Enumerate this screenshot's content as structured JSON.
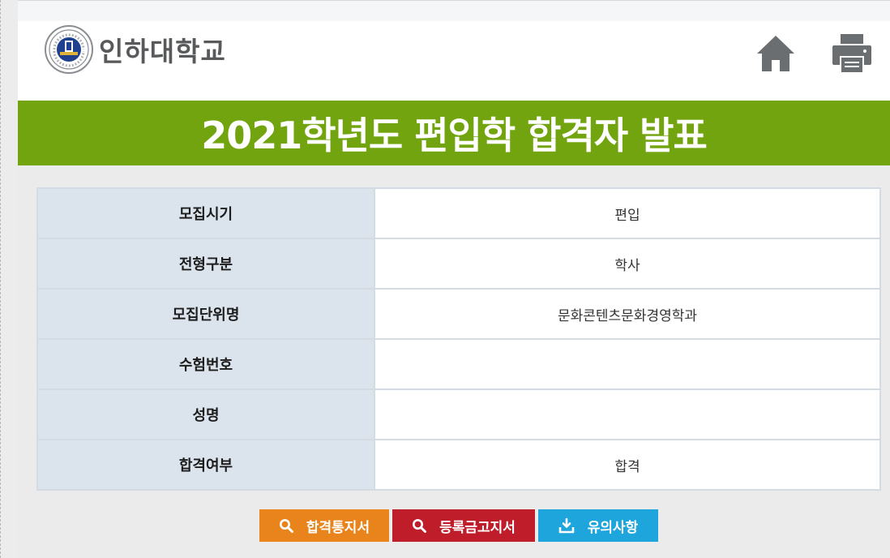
{
  "header": {
    "logo_text": "인하대학교",
    "seal_text": "INHA"
  },
  "banner": {
    "title": "2021학년도 편입학 합격자 발표"
  },
  "table": {
    "rows": [
      {
        "label": "모집시기",
        "value": "편입"
      },
      {
        "label": "전형구분",
        "value": "학사"
      },
      {
        "label": "모집단위명",
        "value": "문화콘텐츠문화경영학과"
      },
      {
        "label": "수험번호",
        "value": ""
      },
      {
        "label": "성명",
        "value": ""
      },
      {
        "label": "합격여부",
        "value": "합격"
      }
    ]
  },
  "buttons": {
    "acceptance_letter": "합격통지서",
    "tuition_notice": "등록금고지서",
    "notes": "유의사항"
  },
  "colors": {
    "banner_green": "#72a40f",
    "label_cell": "#dbe3ec",
    "btn_orange": "#e8841b",
    "btn_red": "#bf1d2a",
    "btn_blue": "#1ea6dc"
  },
  "icons": [
    "home-icon",
    "print-icon",
    "search-icon",
    "download-icon",
    "university-seal-icon"
  ]
}
